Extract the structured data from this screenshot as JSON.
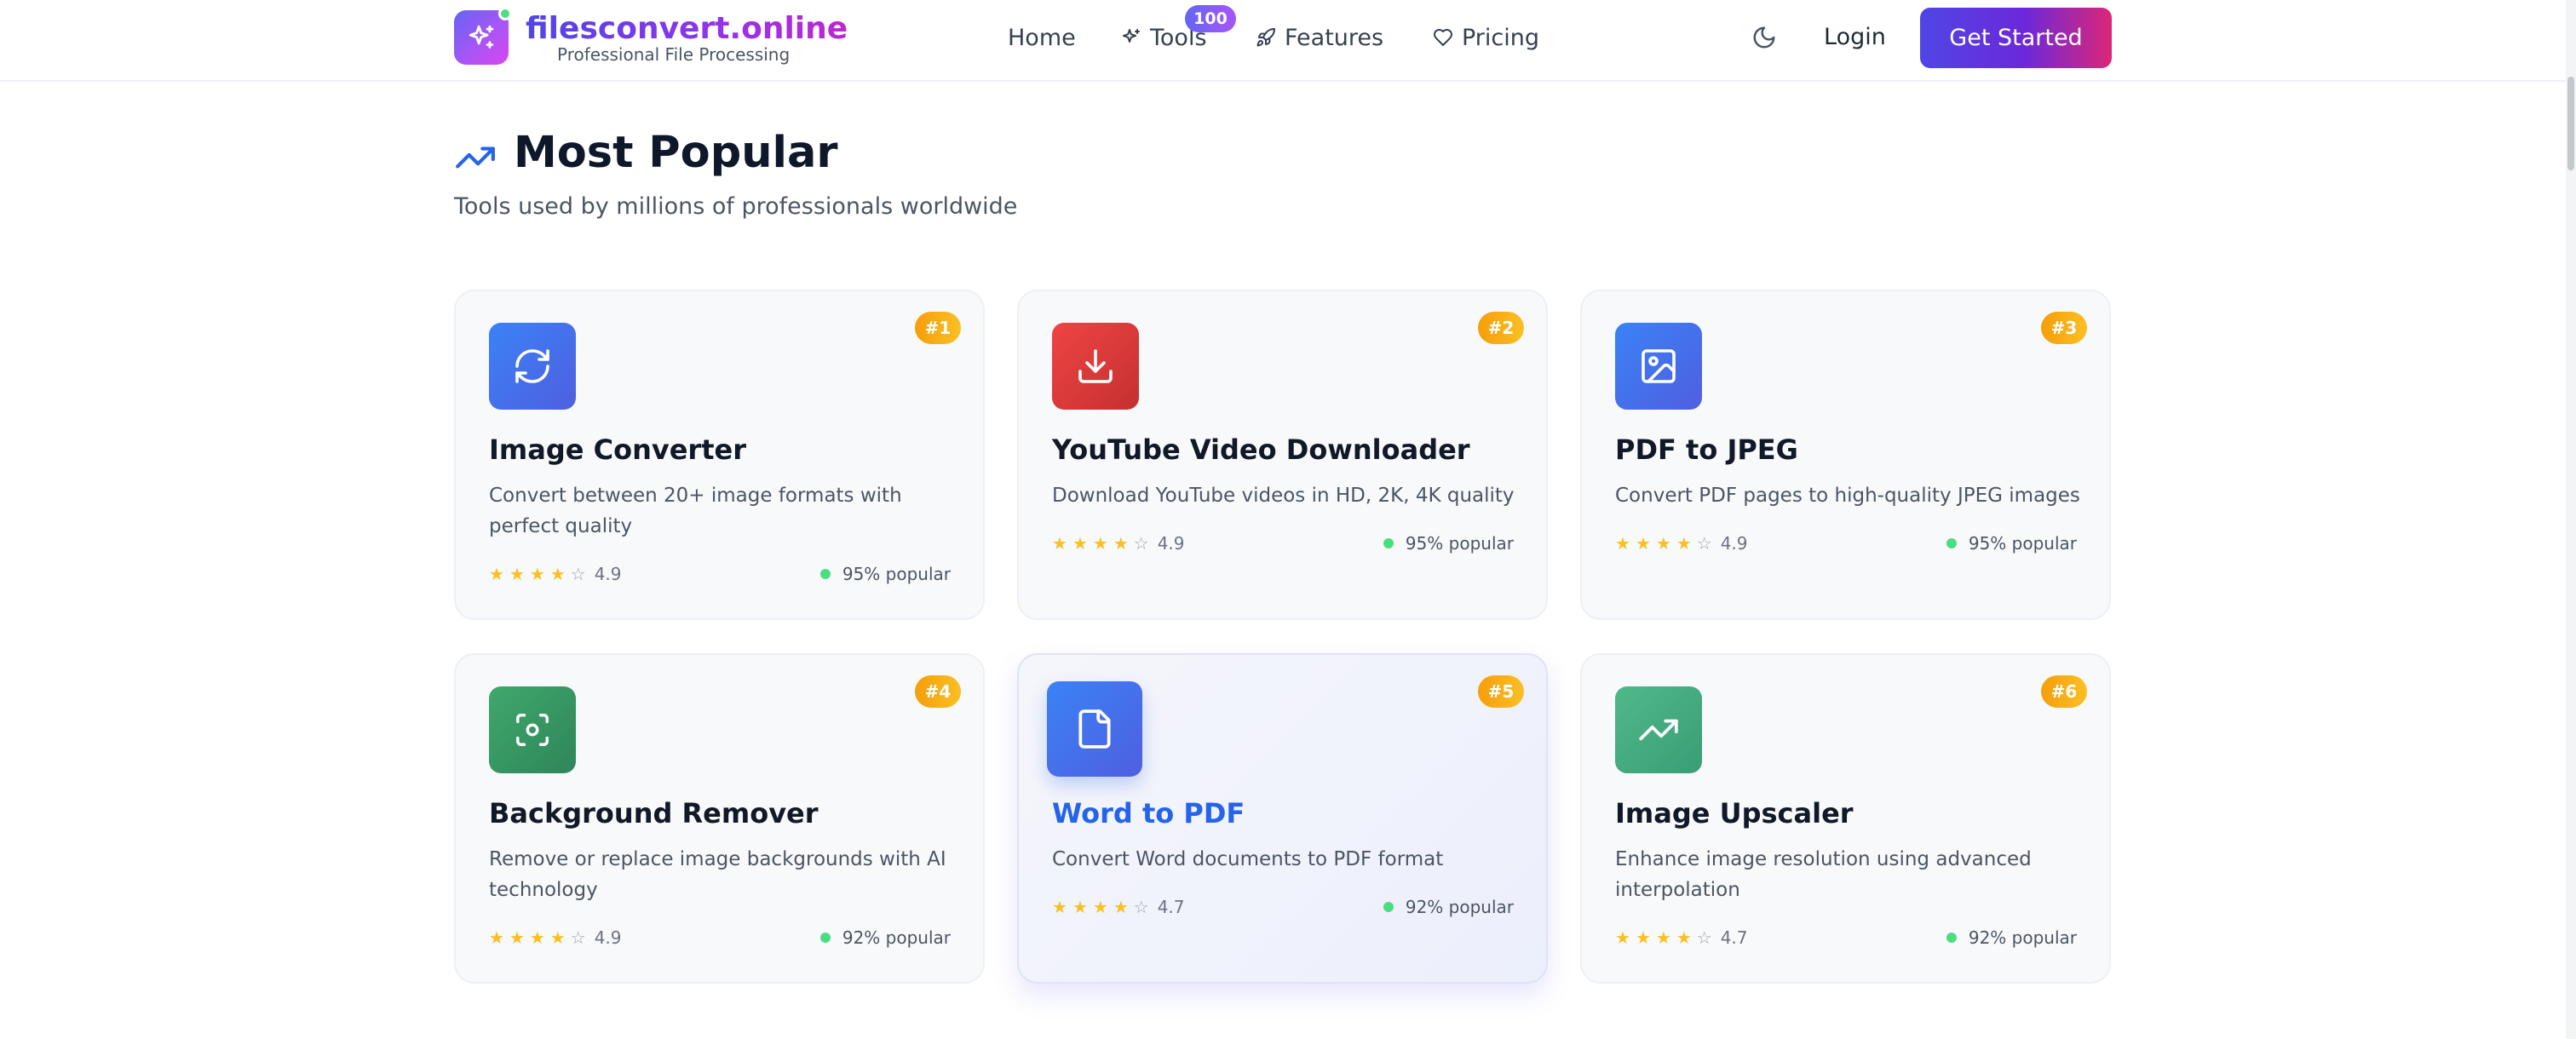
{
  "header": {
    "brand_name": "filesconvert.online",
    "brand_tagline": "Professional File Processing",
    "nav": {
      "home": "Home",
      "tools": "Tools",
      "tools_badge": "100",
      "features": "Features",
      "pricing": "Pricing"
    },
    "login": "Login",
    "cta": "Get Started"
  },
  "section": {
    "title": "Most Popular",
    "subtitle": "Tools used by millions of professionals worldwide"
  },
  "cards": [
    {
      "rank": "#1",
      "icon": "refresh-icon",
      "title": "Image Converter",
      "description": "Convert between 20+ image formats with perfect quality",
      "rating": "4.9",
      "stars": 4,
      "popular": "95% popular",
      "color": "#3b82f6"
    },
    {
      "rank": "#2",
      "icon": "download-icon",
      "title": "YouTube Video Downloader",
      "description": "Download YouTube videos in HD, 2K, 4K quality",
      "rating": "4.9",
      "stars": 4,
      "popular": "95% popular",
      "color": "#ef4444"
    },
    {
      "rank": "#3",
      "icon": "image-icon",
      "title": "PDF to JPEG",
      "description": "Convert PDF pages to high-quality JPEG images",
      "rating": "4.9",
      "stars": 4,
      "popular": "95% popular",
      "color": "#3b82f6"
    },
    {
      "rank": "#4",
      "icon": "scan-focus-icon",
      "title": "Background Remover",
      "description": "Remove or replace image backgrounds with AI technology",
      "rating": "4.9",
      "stars": 4,
      "popular": "92% popular",
      "color": "#3fa86b"
    },
    {
      "rank": "#5",
      "icon": "document-icon",
      "title": "Word to PDF",
      "description": "Convert Word documents to PDF format",
      "rating": "4.7",
      "stars": 4,
      "popular": "92% popular",
      "color": "#3b82f6"
    },
    {
      "rank": "#6",
      "icon": "trending-up-icon",
      "title": "Image Upscaler",
      "description": "Enhance image resolution using advanced interpolation",
      "rating": "4.7",
      "stars": 4,
      "popular": "92% popular",
      "color": "#4fb98a"
    }
  ]
}
